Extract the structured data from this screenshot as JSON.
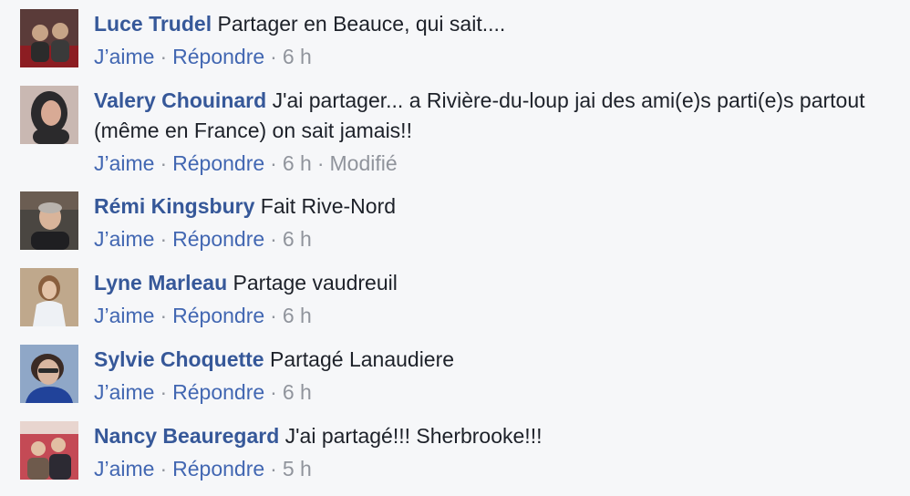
{
  "comments": [
    {
      "author": "Luce Trudel",
      "text": "Partager en Beauce, qui sait....",
      "like_label": "J’aime",
      "reply_label": "Répondre",
      "time": "6 h",
      "edited": "",
      "avatar_colors": [
        "#5a3b39",
        "#c7a487",
        "#8c1d22"
      ]
    },
    {
      "author": "Valery Chouinard",
      "text": "J'ai partager... a Rivière-du-loup jai des ami(e)s parti(e)s partout (même en France) on sait jamais!!",
      "like_label": "J’aime",
      "reply_label": "Répondre",
      "time": "6 h",
      "edited": "Modifié",
      "avatar_colors": [
        "#2b2a2c",
        "#d8aa95",
        "#c9b8b2"
      ]
    },
    {
      "author": "Rémi Kingsbury",
      "text": "Fait Rive-Nord",
      "like_label": "J’aime",
      "reply_label": "Répondre",
      "time": "6 h",
      "edited": "",
      "avatar_colors": [
        "#4a4641",
        "#d9b49a",
        "#1f1f22"
      ]
    },
    {
      "author": "Lyne Marleau",
      "text": "Partage vaudreuil",
      "like_label": "J’aime",
      "reply_label": "Répondre",
      "time": "6 h",
      "edited": "",
      "avatar_colors": [
        "#bfa88c",
        "#e4c3a8",
        "#eef1f5"
      ]
    },
    {
      "author": "Sylvie Choquette",
      "text": "Partagé Lanaudiere",
      "like_label": "J’aime",
      "reply_label": "Répondre",
      "time": "6 h",
      "edited": "",
      "avatar_colors": [
        "#8fa7c7",
        "#d9b6a0",
        "#21439a"
      ]
    },
    {
      "author": "Nancy Beauregard",
      "text": "J'ai partagé!!! Sherbrooke!!!",
      "like_label": "J’aime",
      "reply_label": "Répondre",
      "time": "5 h",
      "edited": "",
      "avatar_colors": [
        "#c44a55",
        "#e2bfa3",
        "#6e5a4c"
      ]
    }
  ]
}
